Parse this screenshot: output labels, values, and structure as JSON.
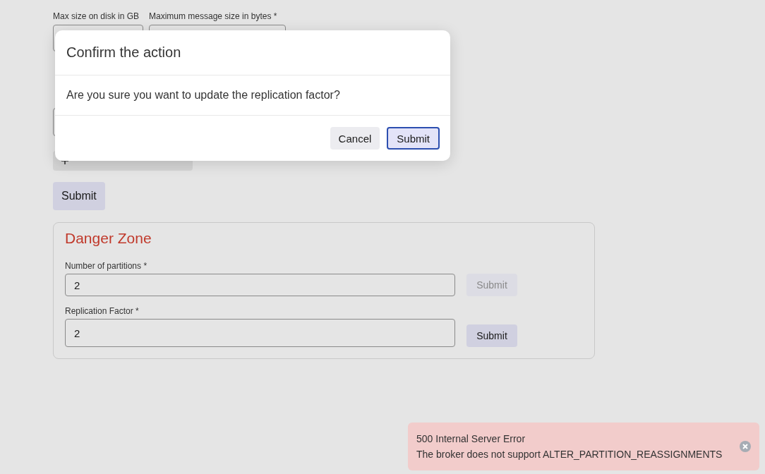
{
  "form": {
    "fields": [
      {
        "label": "Max size on disk in GB"
      },
      {
        "label": "Maximum message size in bytes *"
      }
    ],
    "submit": "Submit"
  },
  "danger_zone": {
    "title": "Danger Zone",
    "fields": [
      {
        "label": "Number of partitions *",
        "value": "2",
        "submit": "Submit",
        "disabled": true
      },
      {
        "label": "Replication Factor *",
        "value": "2",
        "submit": "Submit",
        "disabled": false
      }
    ]
  },
  "modal": {
    "title": "Confirm the action",
    "message": "Are you sure you want to update the replication factor?",
    "buttons": [
      {
        "label": "Cancel",
        "kind": "secondary"
      },
      {
        "label": "Submit",
        "kind": "primary"
      }
    ]
  },
  "toast": {
    "title": "500 Internal Server Error",
    "message": "The broker does not support ALTER_PARTITION_REASSIGNMENTS"
  }
}
